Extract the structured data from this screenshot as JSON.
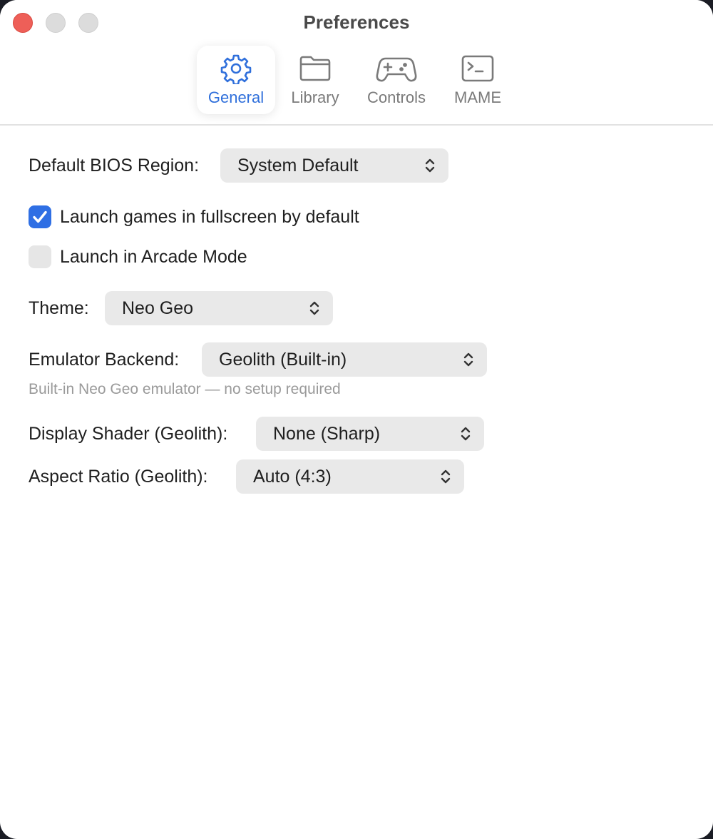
{
  "window": {
    "title": "Preferences"
  },
  "tabs": [
    {
      "label": "General",
      "icon": "gear-icon",
      "selected": true
    },
    {
      "label": "Library",
      "icon": "folder-icon",
      "selected": false
    },
    {
      "label": "Controls",
      "icon": "gamecontroller-icon",
      "selected": false
    },
    {
      "label": "MAME",
      "icon": "terminal-icon",
      "selected": false
    }
  ],
  "general": {
    "bios_region": {
      "label": "Default BIOS Region:",
      "value": "System Default"
    },
    "fullscreen": {
      "label": "Launch games in fullscreen by default",
      "checked": true
    },
    "arcade_mode": {
      "label": "Launch in Arcade Mode",
      "checked": false
    },
    "theme": {
      "label": "Theme:",
      "value": "Neo Geo"
    },
    "backend": {
      "label": "Emulator Backend:",
      "value": "Geolith (Built-in)",
      "hint": "Built-in Neo Geo emulator — no setup required"
    },
    "shader": {
      "label": "Display Shader (Geolith):",
      "value": "None (Sharp)"
    },
    "aspect": {
      "label": "Aspect Ratio (Geolith):",
      "value": "Auto (4:3)"
    }
  },
  "colors": {
    "accent": "#2f6fdb",
    "checkbox_on": "#2f6fe4",
    "close": "#ee5f58"
  }
}
